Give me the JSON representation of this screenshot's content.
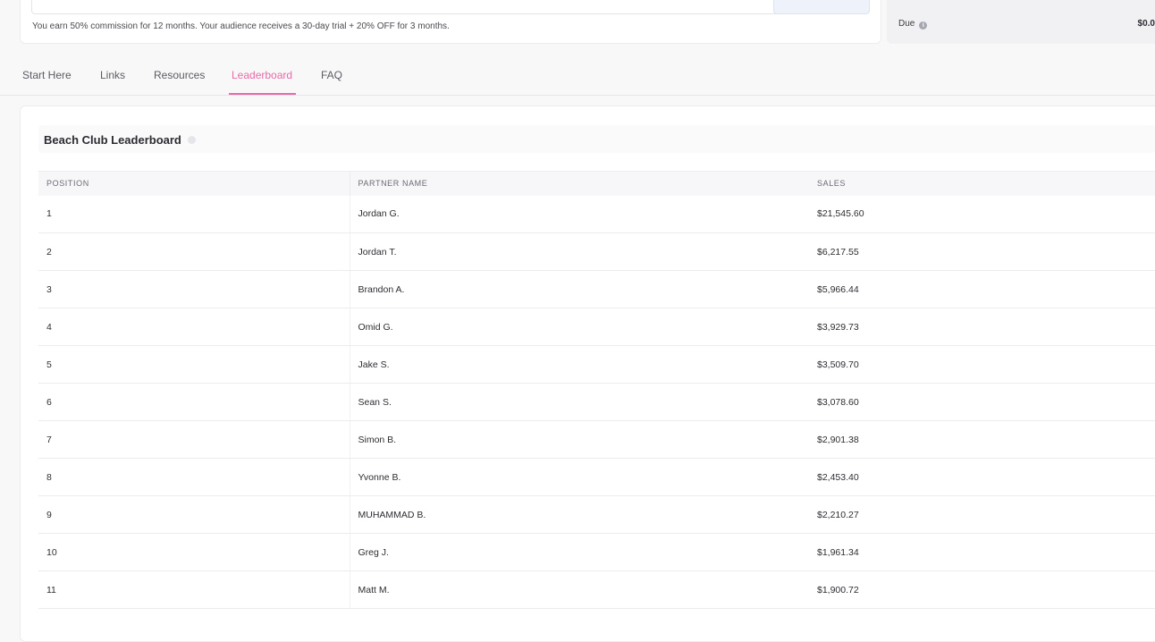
{
  "program": {
    "commission_text": "You earn 50% commission for 12 months. Your audience receives a 30-day trial + 20% OFF for 3 months."
  },
  "balance": {
    "due_label": "Due",
    "due_value": "$0.0"
  },
  "tabs": [
    {
      "label": "Start Here"
    },
    {
      "label": "Links"
    },
    {
      "label": "Resources"
    },
    {
      "label": "Leaderboard",
      "active": true
    },
    {
      "label": "FAQ"
    }
  ],
  "leaderboard": {
    "title": "Beach Club Leaderboard",
    "columns": {
      "position": "POSITION",
      "partner": "PARTNER NAME",
      "sales": "SALES"
    },
    "rows": [
      {
        "position": "1",
        "partner": "Jordan G.",
        "sales": "$21,545.60"
      },
      {
        "position": "2",
        "partner": "Jordan T.",
        "sales": "$6,217.55"
      },
      {
        "position": "3",
        "partner": "Brandon A.",
        "sales": "$5,966.44"
      },
      {
        "position": "4",
        "partner": "Omid G.",
        "sales": "$3,929.73"
      },
      {
        "position": "5",
        "partner": "Jake S.",
        "sales": "$3,509.70"
      },
      {
        "position": "6",
        "partner": "Sean S.",
        "sales": "$3,078.60"
      },
      {
        "position": "7",
        "partner": "Simon B.",
        "sales": "$2,901.38"
      },
      {
        "position": "8",
        "partner": "Yvonne B.",
        "sales": "$2,453.40"
      },
      {
        "position": "9",
        "partner": "MUHAMMAD B.",
        "sales": "$2,210.27"
      },
      {
        "position": "10",
        "partner": "Greg J.",
        "sales": "$1,961.34"
      },
      {
        "position": "11",
        "partner": "Matt M.",
        "sales": "$1,900.72"
      }
    ]
  },
  "colors": {
    "accent": "#e86aa8"
  }
}
